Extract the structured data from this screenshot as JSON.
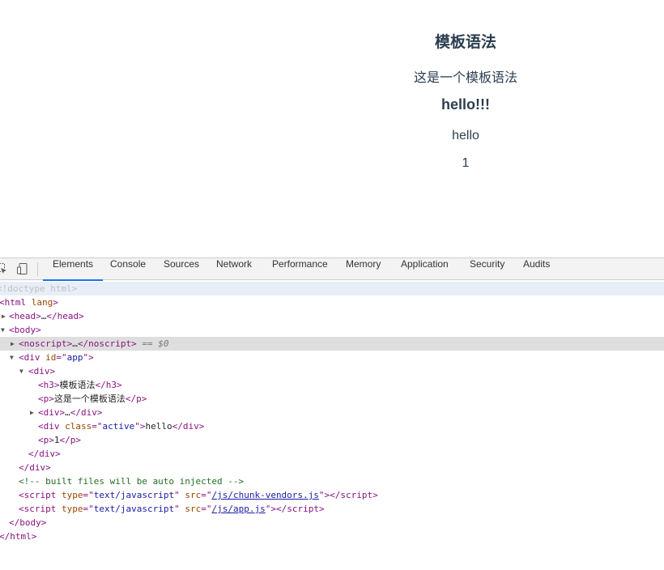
{
  "page": {
    "heading": "模板语法",
    "paragraph": "这是一个模板语法",
    "bold_text": "hello!!!",
    "active_text": "hello",
    "number": "1"
  },
  "devtools": {
    "tabs": [
      "Elements",
      "Console",
      "Sources",
      "Network",
      "Performance",
      "Memory",
      "Application",
      "Security",
      "Audits"
    ],
    "active_tab": "Elements",
    "accent_color": "#1a73e8",
    "dom": {
      "doctype": "<!doctype html>",
      "html_open": "html",
      "html_attr": "lang",
      "head_tag": "head",
      "ellipsis": "…",
      "body_tag": "body",
      "noscript_tag": "noscript",
      "selected_marker": "== $0",
      "div_tag": "div",
      "id_attr": "id",
      "id_value": "app",
      "h3_tag": "h3",
      "h3_text": "模板语法",
      "p_tag": "p",
      "p_text": "这是一个模板语法",
      "class_attr": "class",
      "class_value": "active",
      "active_text": "hello",
      "p2_text": "1",
      "comment": "<!-- built files will be auto injected -->",
      "script_tag": "script",
      "type_attr": "type",
      "type_value": "text/javascript",
      "src_attr": "src",
      "src1": "/js/chunk-vendors.js",
      "src2": "/js/app.js"
    }
  }
}
